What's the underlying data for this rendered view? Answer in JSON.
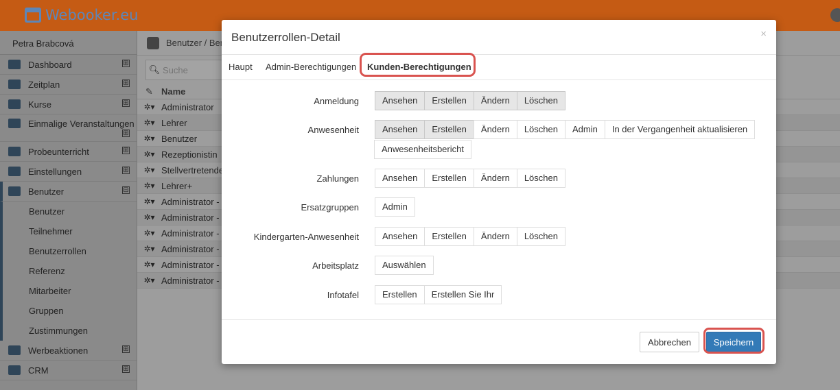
{
  "app": {
    "logo_text": "Webooker.eu"
  },
  "colors": {
    "brand_orange": "#c55b14",
    "primary_blue": "#337ab7",
    "highlight_red": "#d9534f"
  },
  "sidebar": {
    "user_name": "Petra Brabcová",
    "items": [
      {
        "label": "Dashboard",
        "icon": "home-icon",
        "toggle": "⊞"
      },
      {
        "label": "Zeitplan",
        "icon": "calendar-icon",
        "toggle": "⊞"
      },
      {
        "label": "Kurse",
        "icon": "book-icon",
        "toggle": "⊞"
      },
      {
        "label": "Einmalige Veranstaltungen",
        "icon": "soccer-ball-icon",
        "toggle": "⊞"
      },
      {
        "label": "Probeunterricht",
        "icon": "eye-slash-icon",
        "toggle": "⊞"
      },
      {
        "label": "Einstellungen",
        "icon": "server-icon",
        "toggle": "⊞"
      },
      {
        "label": "Benutzer",
        "icon": "users-icon",
        "toggle": "⊟"
      }
    ],
    "subitems": [
      "Benutzer",
      "Teilnehmer",
      "Benutzerrollen",
      "Referenz",
      "Mitarbeiter",
      "Gruppen",
      "Zustimmungen"
    ],
    "bottom_items": [
      {
        "label": "Werbeaktionen",
        "icon": "gift-icon",
        "toggle": "⊞"
      },
      {
        "label": "CRM",
        "icon": "handshake-icon",
        "toggle": "⊞"
      }
    ]
  },
  "content": {
    "breadcrumb": "Benutzer / Ben",
    "search_placeholder": "Suche",
    "table": {
      "header_name": "Name",
      "rows": [
        "Administrator",
        "Lehrer",
        "Benutzer",
        "Rezeptionistin",
        "Stellvertretende",
        "Lehrer+",
        "Administrator -",
        "Administrator -",
        "Administrator -",
        "Administrator -",
        "Administrator -",
        "Administrator -"
      ],
      "row_action": "✲▾"
    }
  },
  "modal": {
    "title": "Benutzerrollen-Detail",
    "close": "×",
    "tabs": [
      "Haupt",
      "Admin-Berechtigungen",
      "Kunden-Berechtigungen"
    ],
    "permissions": [
      {
        "label": "Anmeldung",
        "buttons": [
          {
            "text": "Ansehen",
            "on": true
          },
          {
            "text": "Erstellen",
            "on": true
          },
          {
            "text": "Ändern",
            "on": true
          },
          {
            "text": "Löschen",
            "on": true
          }
        ]
      },
      {
        "label": "Anwesenheit",
        "buttons": [
          {
            "text": "Ansehen",
            "on": true
          },
          {
            "text": "Erstellen",
            "on": true
          },
          {
            "text": "Ändern",
            "on": false
          },
          {
            "text": "Löschen",
            "on": false
          },
          {
            "text": "Admin",
            "on": false
          },
          {
            "text": "In der Vergangenheit aktualisieren",
            "on": false
          }
        ],
        "buttons2": [
          {
            "text": "Anwesenheitsbericht",
            "on": false
          }
        ]
      },
      {
        "label": "Zahlungen",
        "buttons": [
          {
            "text": "Ansehen",
            "on": false
          },
          {
            "text": "Erstellen",
            "on": false
          },
          {
            "text": "Ändern",
            "on": false
          },
          {
            "text": "Löschen",
            "on": false
          }
        ]
      },
      {
        "label": "Ersatzgruppen",
        "buttons": [
          {
            "text": "Admin",
            "on": false
          }
        ]
      },
      {
        "label": "Kindergarten-Anwesenheit",
        "buttons": [
          {
            "text": "Ansehen",
            "on": false
          },
          {
            "text": "Erstellen",
            "on": false
          },
          {
            "text": "Ändern",
            "on": false
          },
          {
            "text": "Löschen",
            "on": false
          }
        ]
      },
      {
        "label": "Arbeitsplatz",
        "buttons": [
          {
            "text": "Auswählen",
            "on": false
          }
        ]
      },
      {
        "label": "Infotafel",
        "buttons": [
          {
            "text": "Erstellen",
            "on": false
          },
          {
            "text": "Erstellen Sie Ihr",
            "on": false
          }
        ]
      }
    ],
    "cancel_label": "Abbrechen",
    "save_label": "Speichern"
  }
}
